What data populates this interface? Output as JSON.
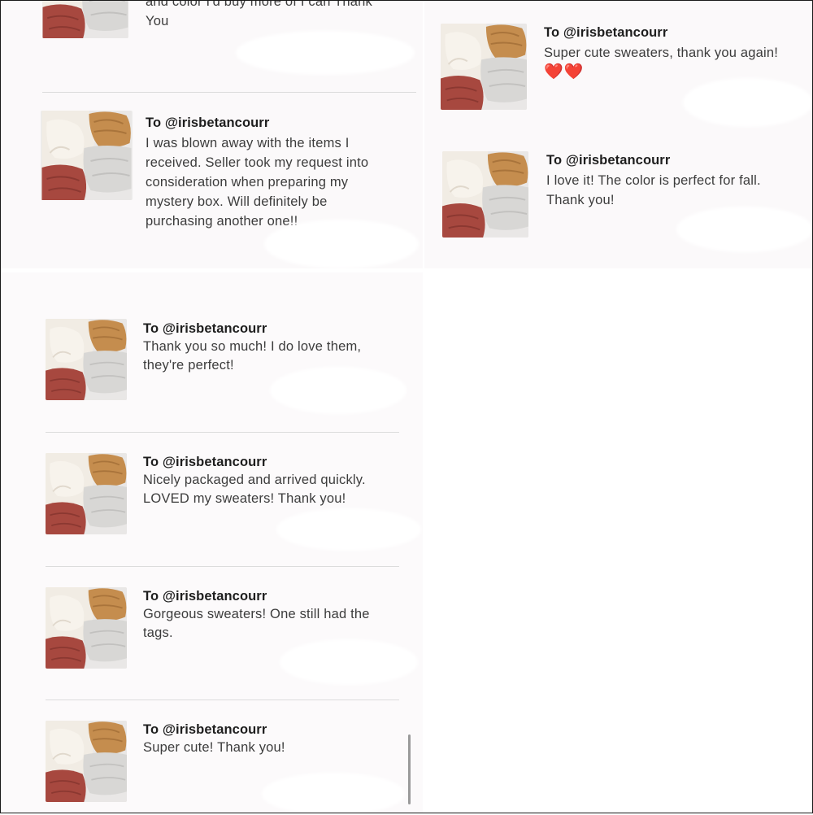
{
  "reviews": {
    "cut_top": {
      "text_line1": "and color I'd buy more of I can Thank",
      "text_line2": "You"
    },
    "r1": {
      "to": "To @irisbetancourr",
      "text": "I was blown away with the items I received. Seller took my request into consideration when preparing my mystery box. Will definitely be purchasing another one!!"
    },
    "r2": {
      "to": "To @irisbetancourr",
      "text": "Super cute sweaters, thank you again!",
      "hearts": "❤️❤️"
    },
    "r3": {
      "to": "To @irisbetancourr",
      "text": "I love it! The color is perfect for fall. Thank you!"
    },
    "r4": {
      "to": "To @irisbetancourr",
      "text": "Thank you so much! I do love them, they're perfect!"
    },
    "r5": {
      "to": "To @irisbetancourr",
      "text": "Nicely packaged and arrived quickly. LOVED my sweaters! Thank you!"
    },
    "r6": {
      "to": "To @irisbetancourr",
      "text": "Gorgeous sweaters! One still had the tags."
    },
    "r7": {
      "to": "To @irisbetancourr",
      "text": "Super cute! Thank you!"
    }
  },
  "thumbnail_icon": "folded-sweaters-photo",
  "colors": {
    "sweater_cream": "#efe9df",
    "sweater_mustard": "#c08a4c",
    "sweater_grey": "#d5d4d2",
    "sweater_rust": "#a4473f",
    "heart": "#e52b2b"
  }
}
